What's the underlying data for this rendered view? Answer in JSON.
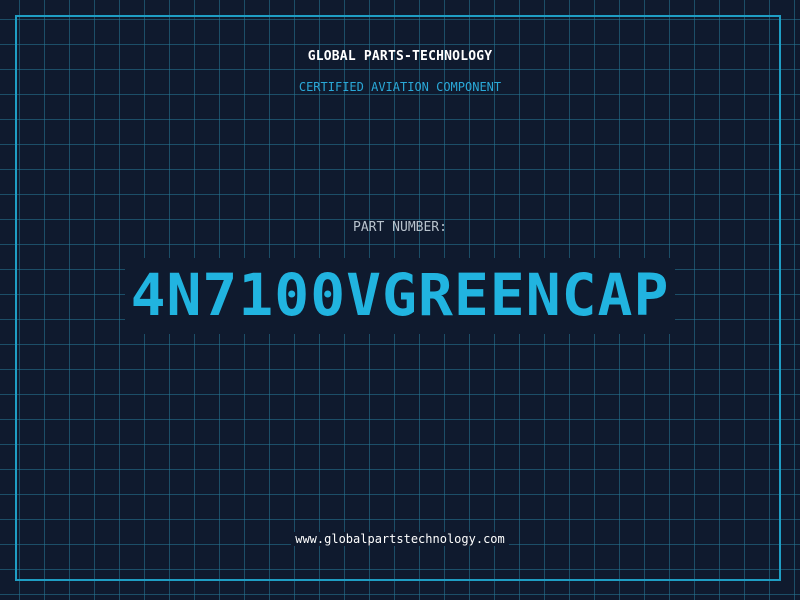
{
  "header": {
    "company": "GLOBAL PARTS-TECHNOLOGY",
    "tagline": "CERTIFIED AVIATION COMPONENT"
  },
  "part": {
    "label": "PART NUMBER:",
    "number": "4N7100VGREENCAP"
  },
  "footer": {
    "url": "www.globalpartstechnology.com"
  },
  "colors": {
    "background": "#0f1a2e",
    "grid": "#267896",
    "accent": "#21b4e0",
    "frame": "#1f9ec4"
  }
}
